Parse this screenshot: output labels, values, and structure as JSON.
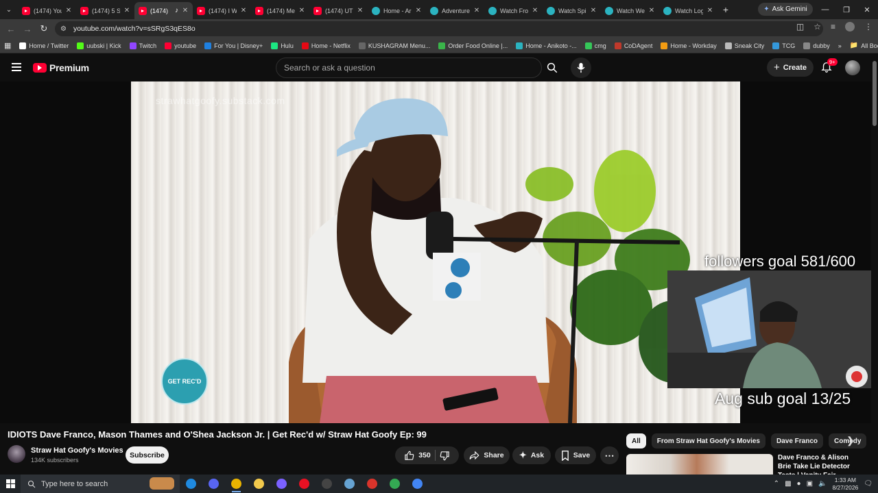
{
  "browser": {
    "tabs": [
      {
        "label": "(1474) You",
        "icon": "youtube-icon",
        "active": false
      },
      {
        "label": "(1474) 5 S",
        "icon": "youtube-icon",
        "active": false
      },
      {
        "label": "(1474)",
        "icon": "youtube-icon",
        "active": true,
        "audio": true
      },
      {
        "label": "(1474) I W",
        "icon": "youtube-icon",
        "active": false
      },
      {
        "label": "(1474) Me",
        "icon": "youtube-icon",
        "active": false
      },
      {
        "label": "(1474) UT",
        "icon": "youtube-icon",
        "active": false
      },
      {
        "label": "Home - Ar",
        "icon": "globe-icon",
        "active": false
      },
      {
        "label": "Adventure",
        "icon": "globe-icon",
        "active": false
      },
      {
        "label": "Watch Fro",
        "icon": "globe-icon",
        "active": false
      },
      {
        "label": "Watch Spi",
        "icon": "globe-icon",
        "active": false
      },
      {
        "label": "Watch We",
        "icon": "globe-icon",
        "active": false
      },
      {
        "label": "Watch Log",
        "icon": "globe-icon",
        "active": false
      }
    ],
    "gemini_label": "Ask Gemini",
    "url": "youtube.com/watch?v=sSRgS3qES8o",
    "bookmarks": [
      {
        "label": "Home / Twitter",
        "color": "#ffffff"
      },
      {
        "label": "uubski | Kick",
        "color": "#53fc18"
      },
      {
        "label": "Twitch",
        "color": "#9146ff"
      },
      {
        "label": "youtube",
        "color": "#ff0033"
      },
      {
        "label": "For You | Disney+",
        "color": "#1f80e0"
      },
      {
        "label": "Hulu",
        "color": "#1ce783"
      },
      {
        "label": "Home - Netflix",
        "color": "#e50914"
      },
      {
        "label": "KUSHAGRAM Menu...",
        "color": "#666666"
      },
      {
        "label": "Order Food Online |...",
        "color": "#3ab54a"
      },
      {
        "label": "Home - Anikoto -...",
        "color": "#2bb3c0"
      },
      {
        "label": "cmg",
        "color": "#35c759"
      },
      {
        "label": "CoDAgent",
        "color": "#c0392b"
      },
      {
        "label": "Home - Workday",
        "color": "#f39c12"
      },
      {
        "label": "Sneak City",
        "color": "#bbbbbb"
      },
      {
        "label": "TCG",
        "color": "#3498db"
      },
      {
        "label": "dubby",
        "color": "#888888"
      }
    ],
    "all_bookmarks_label": "All Bookmarks"
  },
  "youtube": {
    "logo_text": "Premium",
    "search_placeholder": "Search or ask a question",
    "create_label": "Create",
    "notification_badge": "9+",
    "brand_color": "#ff0033"
  },
  "video": {
    "watermark": "strawhatgoofy.substack.com",
    "logo_badge": "GET REC'D",
    "followers_goal": "followers goal 581/600",
    "sub_goal": "Aug sub goal 13/25",
    "title": "IDIOTS Dave Franco, Mason Thames and O'Shea Jackson Jr. | Get Rec'd w/ Straw Hat Goofy Ep: 99",
    "channel_name": "Straw Hat Goofy's Movies",
    "subscribers": "134K subscribers",
    "subscribe_label": "Subscribe",
    "likes": "350",
    "share_label": "Share",
    "ask_label": "Ask",
    "save_label": "Save"
  },
  "sidebar": {
    "chips": [
      "All",
      "From Straw Hat Goofy's Movies",
      "Dave Franco",
      "Comedy"
    ],
    "recommended_title": "Dave Franco & Alison Brie Take Lie Detector Tests | Vanity Fair"
  },
  "taskbar": {
    "search_placeholder": "Type here to search",
    "time": "1:33 AM",
    "date": "8/27/2026",
    "apps": [
      {
        "name": "edge-icon",
        "color": "#1f8ae0"
      },
      {
        "name": "discord-icon",
        "color": "#5865f2"
      },
      {
        "name": "chrome-icon",
        "color": "#e8b300",
        "open": true
      },
      {
        "name": "file-explorer-icon",
        "color": "#f2c94c"
      },
      {
        "name": "game-controller-icon",
        "color": "#7b61ff"
      },
      {
        "name": "media-player-icon",
        "color": "#e81123"
      },
      {
        "name": "obs-icon",
        "color": "#444444"
      },
      {
        "name": "steam-icon",
        "color": "#66a3d2"
      },
      {
        "name": "acrobat-icon",
        "color": "#d9342b"
      },
      {
        "name": "chrome-alt-icon",
        "color": "#34a853"
      },
      {
        "name": "chrome-profile-icon",
        "color": "#4285f4"
      }
    ]
  }
}
